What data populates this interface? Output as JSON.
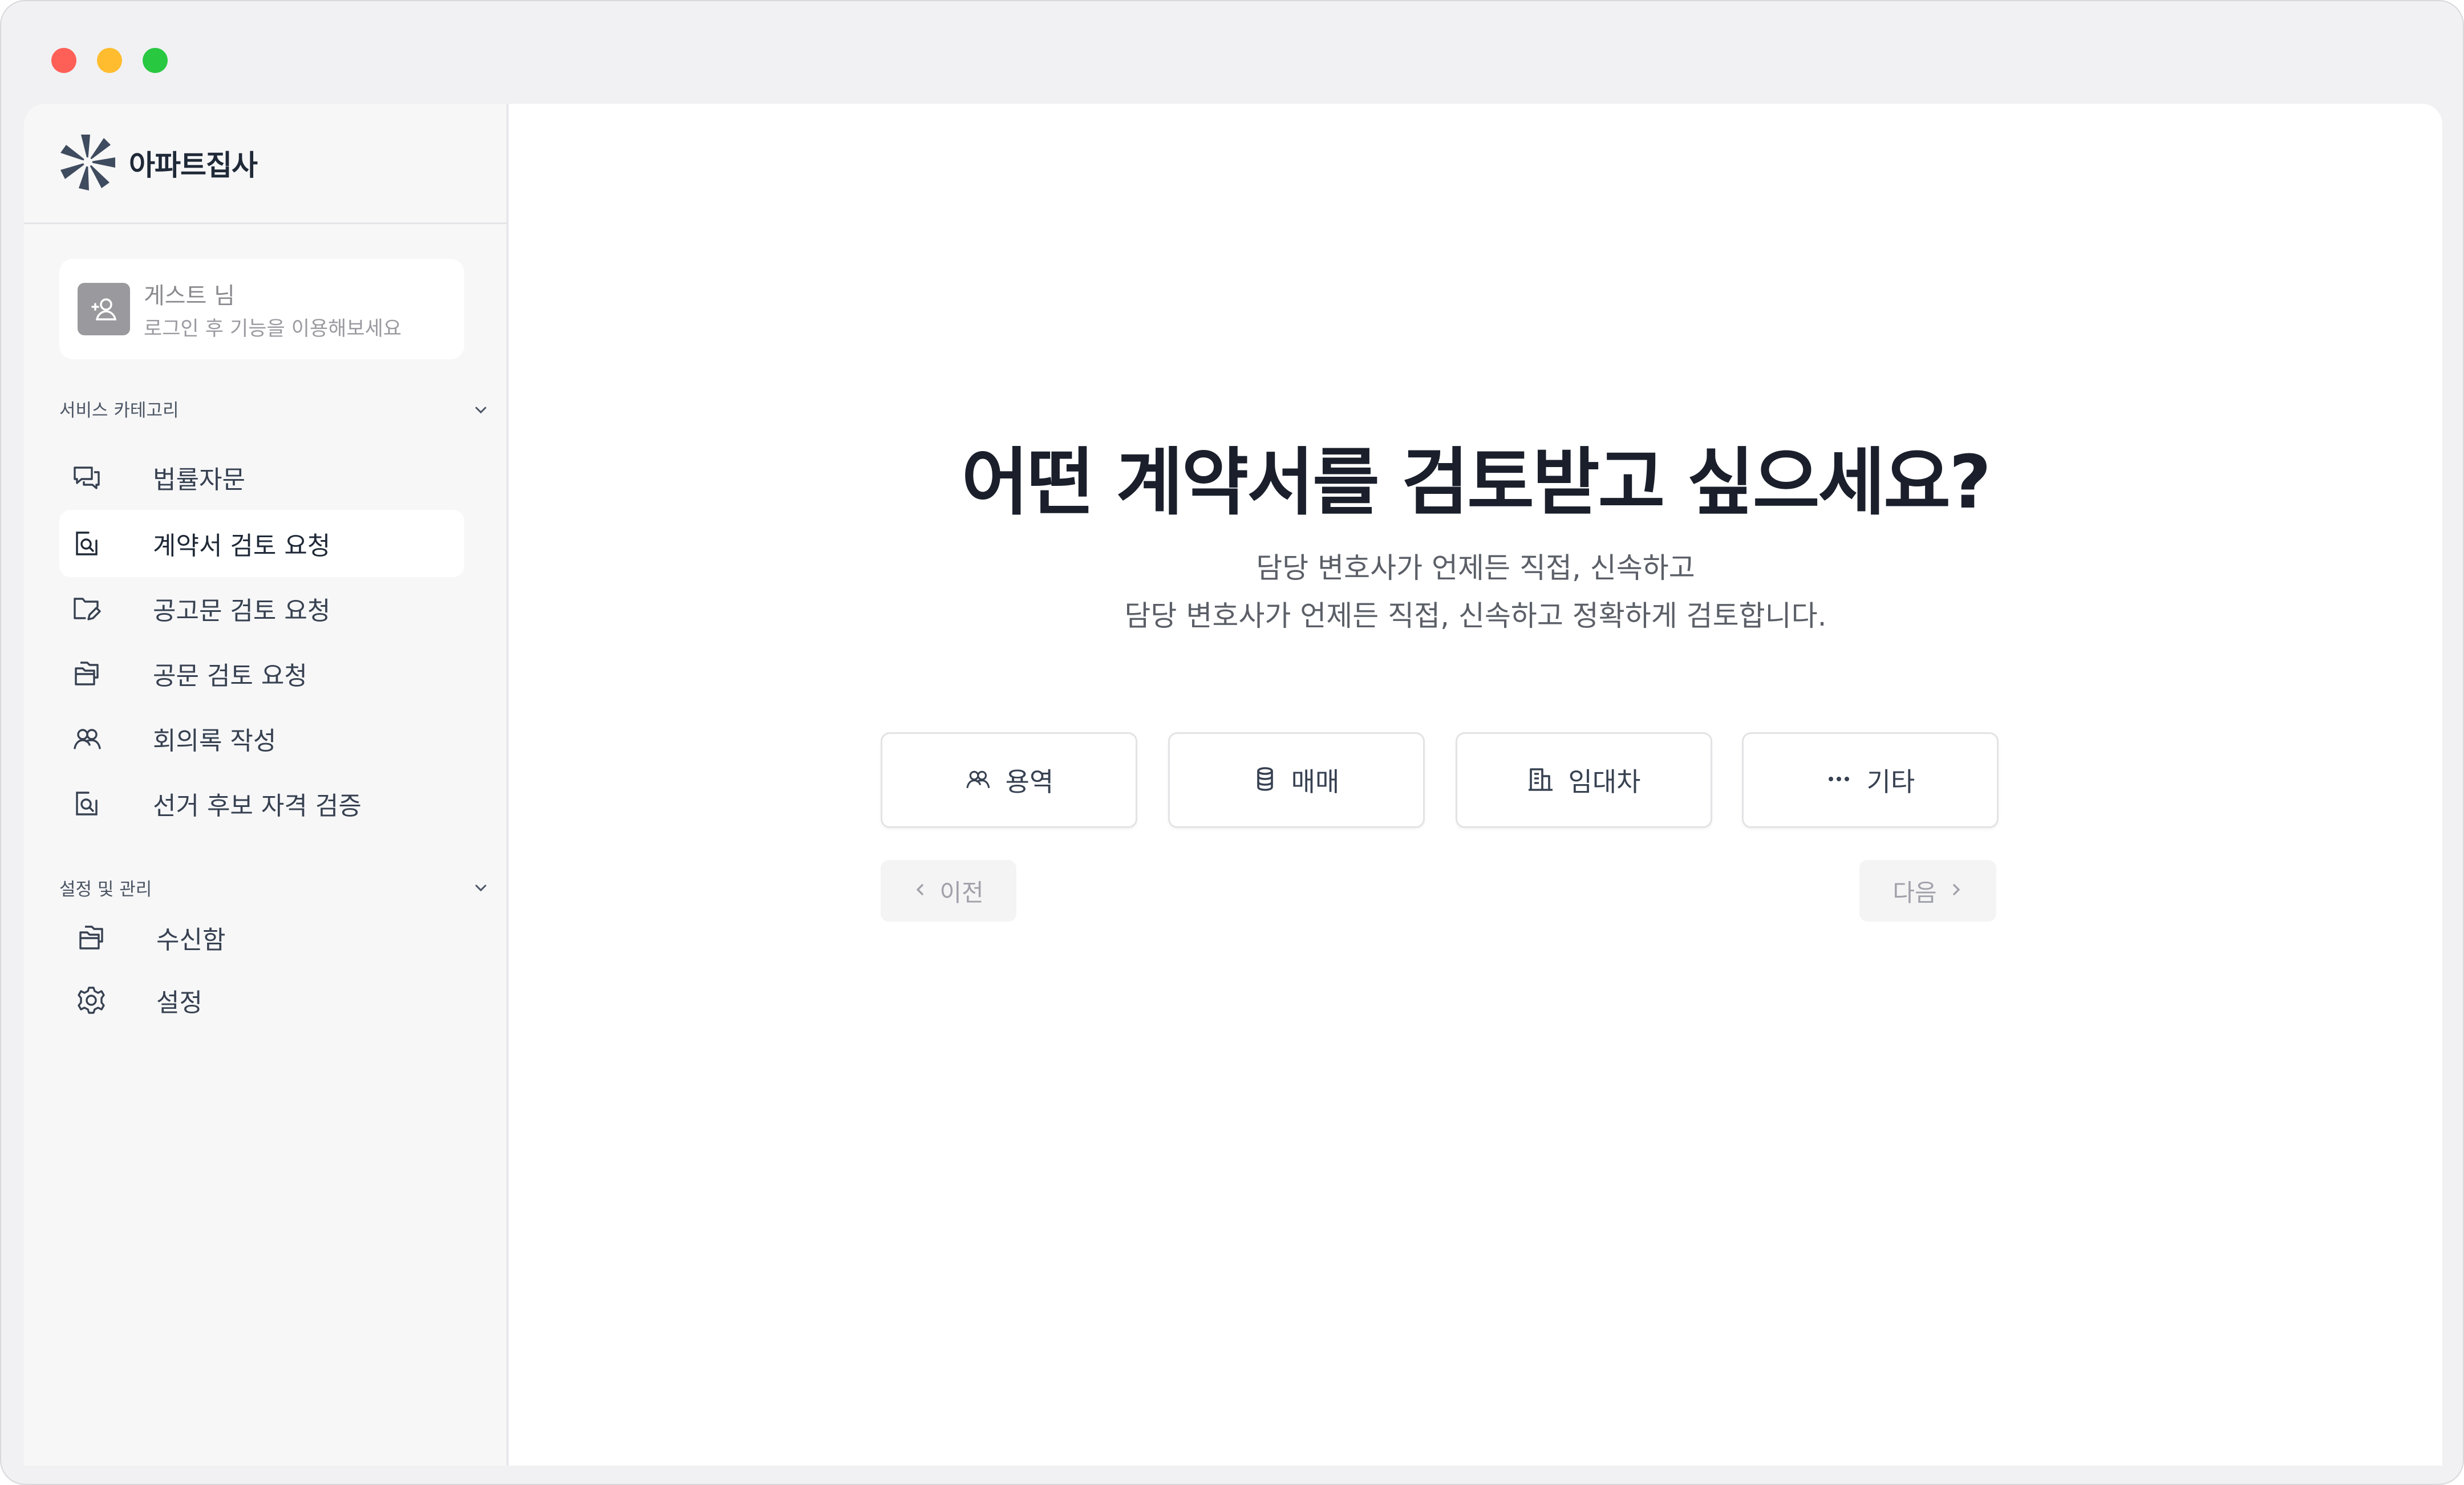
{
  "window": {
    "controls": [
      "close",
      "minimize",
      "maximize"
    ]
  },
  "brand": {
    "name": "아파트집사",
    "logo_icon": "starburst-logo"
  },
  "user": {
    "name": "게스트 님",
    "hint": "로그인 후 기능을 이용해보세요",
    "avatar_icon": "user-plus-icon"
  },
  "sidebar": {
    "service_section": {
      "title": "서비스 카테고리",
      "items": [
        {
          "label": "법률자문",
          "icon": "chat-bubbles-icon",
          "active": false
        },
        {
          "label": "계약서 검토 요청",
          "icon": "document-search-icon",
          "active": true
        },
        {
          "label": "공고문 검토 요청",
          "icon": "folder-edit-icon",
          "active": false
        },
        {
          "label": "공문 검토 요청",
          "icon": "stacked-folders-icon",
          "active": false
        },
        {
          "label": "회의록 작성",
          "icon": "people-icon",
          "active": false
        },
        {
          "label": "선거 후보 자격 검증",
          "icon": "document-search-icon",
          "active": false
        }
      ]
    },
    "settings_section": {
      "title": "설정 및 관리",
      "items": [
        {
          "label": "수신함",
          "icon": "stacked-folders-icon"
        },
        {
          "label": "설정",
          "icon": "gear-icon"
        }
      ]
    }
  },
  "main": {
    "headline": "어떤 계약서를 검토받고 싶으세요?",
    "subtitle_line1": "담당 변호사가 언제든 직접, 신속하고",
    "subtitle_line2": "담당 변호사가 언제든 직접, 신속하고 정확하게 검토합니다.",
    "options": [
      {
        "label": "용역",
        "icon": "people-icon"
      },
      {
        "label": "매매",
        "icon": "database-icon"
      },
      {
        "label": "임대차",
        "icon": "building-icon"
      },
      {
        "label": "기타",
        "icon": "more-dots-icon"
      }
    ],
    "prev_label": "이전",
    "next_label": "다음"
  },
  "colors": {
    "window_bg": "#f1f1f3",
    "sidebar_bg": "#f7f7f8",
    "main_bg": "#ffffff",
    "headline": "#1a1f2b",
    "brand_logo": "#3f4b5e",
    "disabled_text": "#a1a1aa"
  }
}
